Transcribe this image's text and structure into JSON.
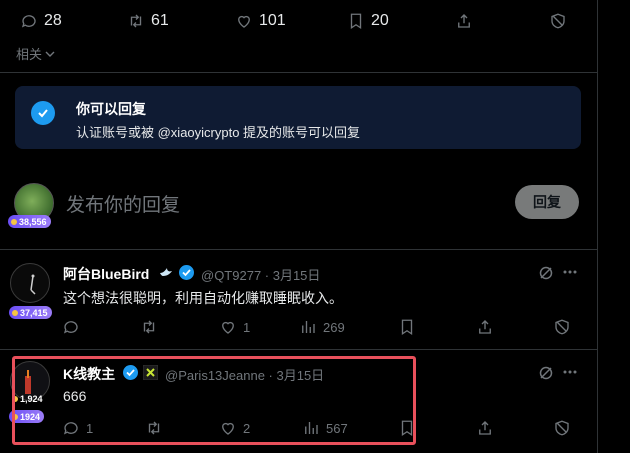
{
  "top_actions": {
    "comments": "28",
    "retweets": "61",
    "likes": "101",
    "bookmarks": "20"
  },
  "related": {
    "label": "相关"
  },
  "notice": {
    "title": "你可以回复",
    "text": "认证账号或被 @xiaoyicrypto 提及的账号可以回复"
  },
  "composer": {
    "placeholder": "发布你的回复",
    "score": "38,556",
    "button": "回复"
  },
  "tweets": [
    {
      "name": "阿台BlueBird",
      "handle": "@QT9277 · 3月15日",
      "text": "这个想法很聪明，利用自动化赚取睡眠收入。",
      "score": "37,415",
      "comments": "",
      "likes": "1",
      "views": "269"
    },
    {
      "name": "K线教主",
      "handle": "@Paris13Jeanne · 3月15日",
      "text": "666",
      "score": "1924",
      "score_overlay": "1,924",
      "comments": "1",
      "likes": "2",
      "views": "567"
    }
  ],
  "colors": {
    "accent": "#1d9bf0",
    "highlight": "#e8505b",
    "score_badge": "#7b5cf6"
  }
}
